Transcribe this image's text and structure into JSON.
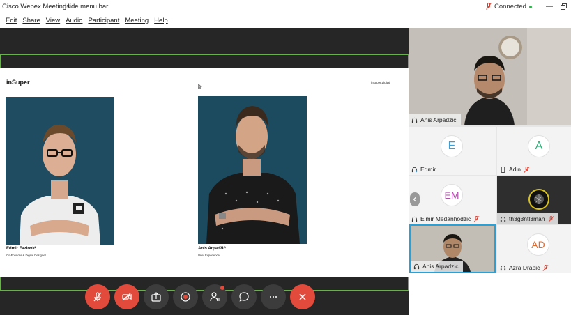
{
  "window": {
    "title": "Cisco Webex Meetings",
    "hide_menu_label": "Hide menu bar",
    "connection_status": "Connected",
    "status_color": "#2fb44a"
  },
  "menu": {
    "items": [
      "Edit",
      "Share",
      "View",
      "Audio",
      "Participant",
      "Meeting",
      "Help"
    ]
  },
  "slide": {
    "brand": "inSuper",
    "website": "insuper.digital",
    "people": [
      {
        "name": "Edmir Fazlović",
        "role": "Co-Founder & Digital Designer"
      },
      {
        "name": "Anis Arpadžić",
        "role": "User Experience"
      }
    ]
  },
  "toolbar": {
    "buttons": [
      {
        "name": "mute",
        "icon": "microphone-muted-icon",
        "color": "#e24b3b"
      },
      {
        "name": "video",
        "icon": "video-off-icon",
        "color": "#e24b3b"
      },
      {
        "name": "share",
        "icon": "share-icon",
        "color": "#3c3c3c"
      },
      {
        "name": "record",
        "icon": "record-icon",
        "color": "#3c3c3c"
      },
      {
        "name": "participants",
        "icon": "participants-icon",
        "color": "#3c3c3c"
      },
      {
        "name": "chat",
        "icon": "chat-icon",
        "color": "#3c3c3c"
      },
      {
        "name": "more",
        "icon": "more-icon",
        "color": "#3c3c3c"
      },
      {
        "name": "leave",
        "icon": "close-icon",
        "color": "#e24b3b"
      }
    ]
  },
  "participants": [
    {
      "name": "Anis Arpadzic",
      "type": "video"
    },
    {
      "name": "Edmir",
      "initials": "E",
      "initials_color": "#3a9fd6"
    },
    {
      "name": "Adin",
      "initials": "A",
      "initials_color": "#2db37a",
      "muted": true
    },
    {
      "name": "Elmir Medanhodzic",
      "initials": "EM",
      "initials_color": "#b04ba8",
      "muted": true
    },
    {
      "name": "th3g3ntl3man",
      "type": "avatar",
      "muted": true
    },
    {
      "name": "Anis Arpadzic",
      "type": "video",
      "selected": true
    },
    {
      "name": "Azra Drapić",
      "initials": "AD",
      "initials_color": "#e36a2b",
      "muted": true
    }
  ]
}
